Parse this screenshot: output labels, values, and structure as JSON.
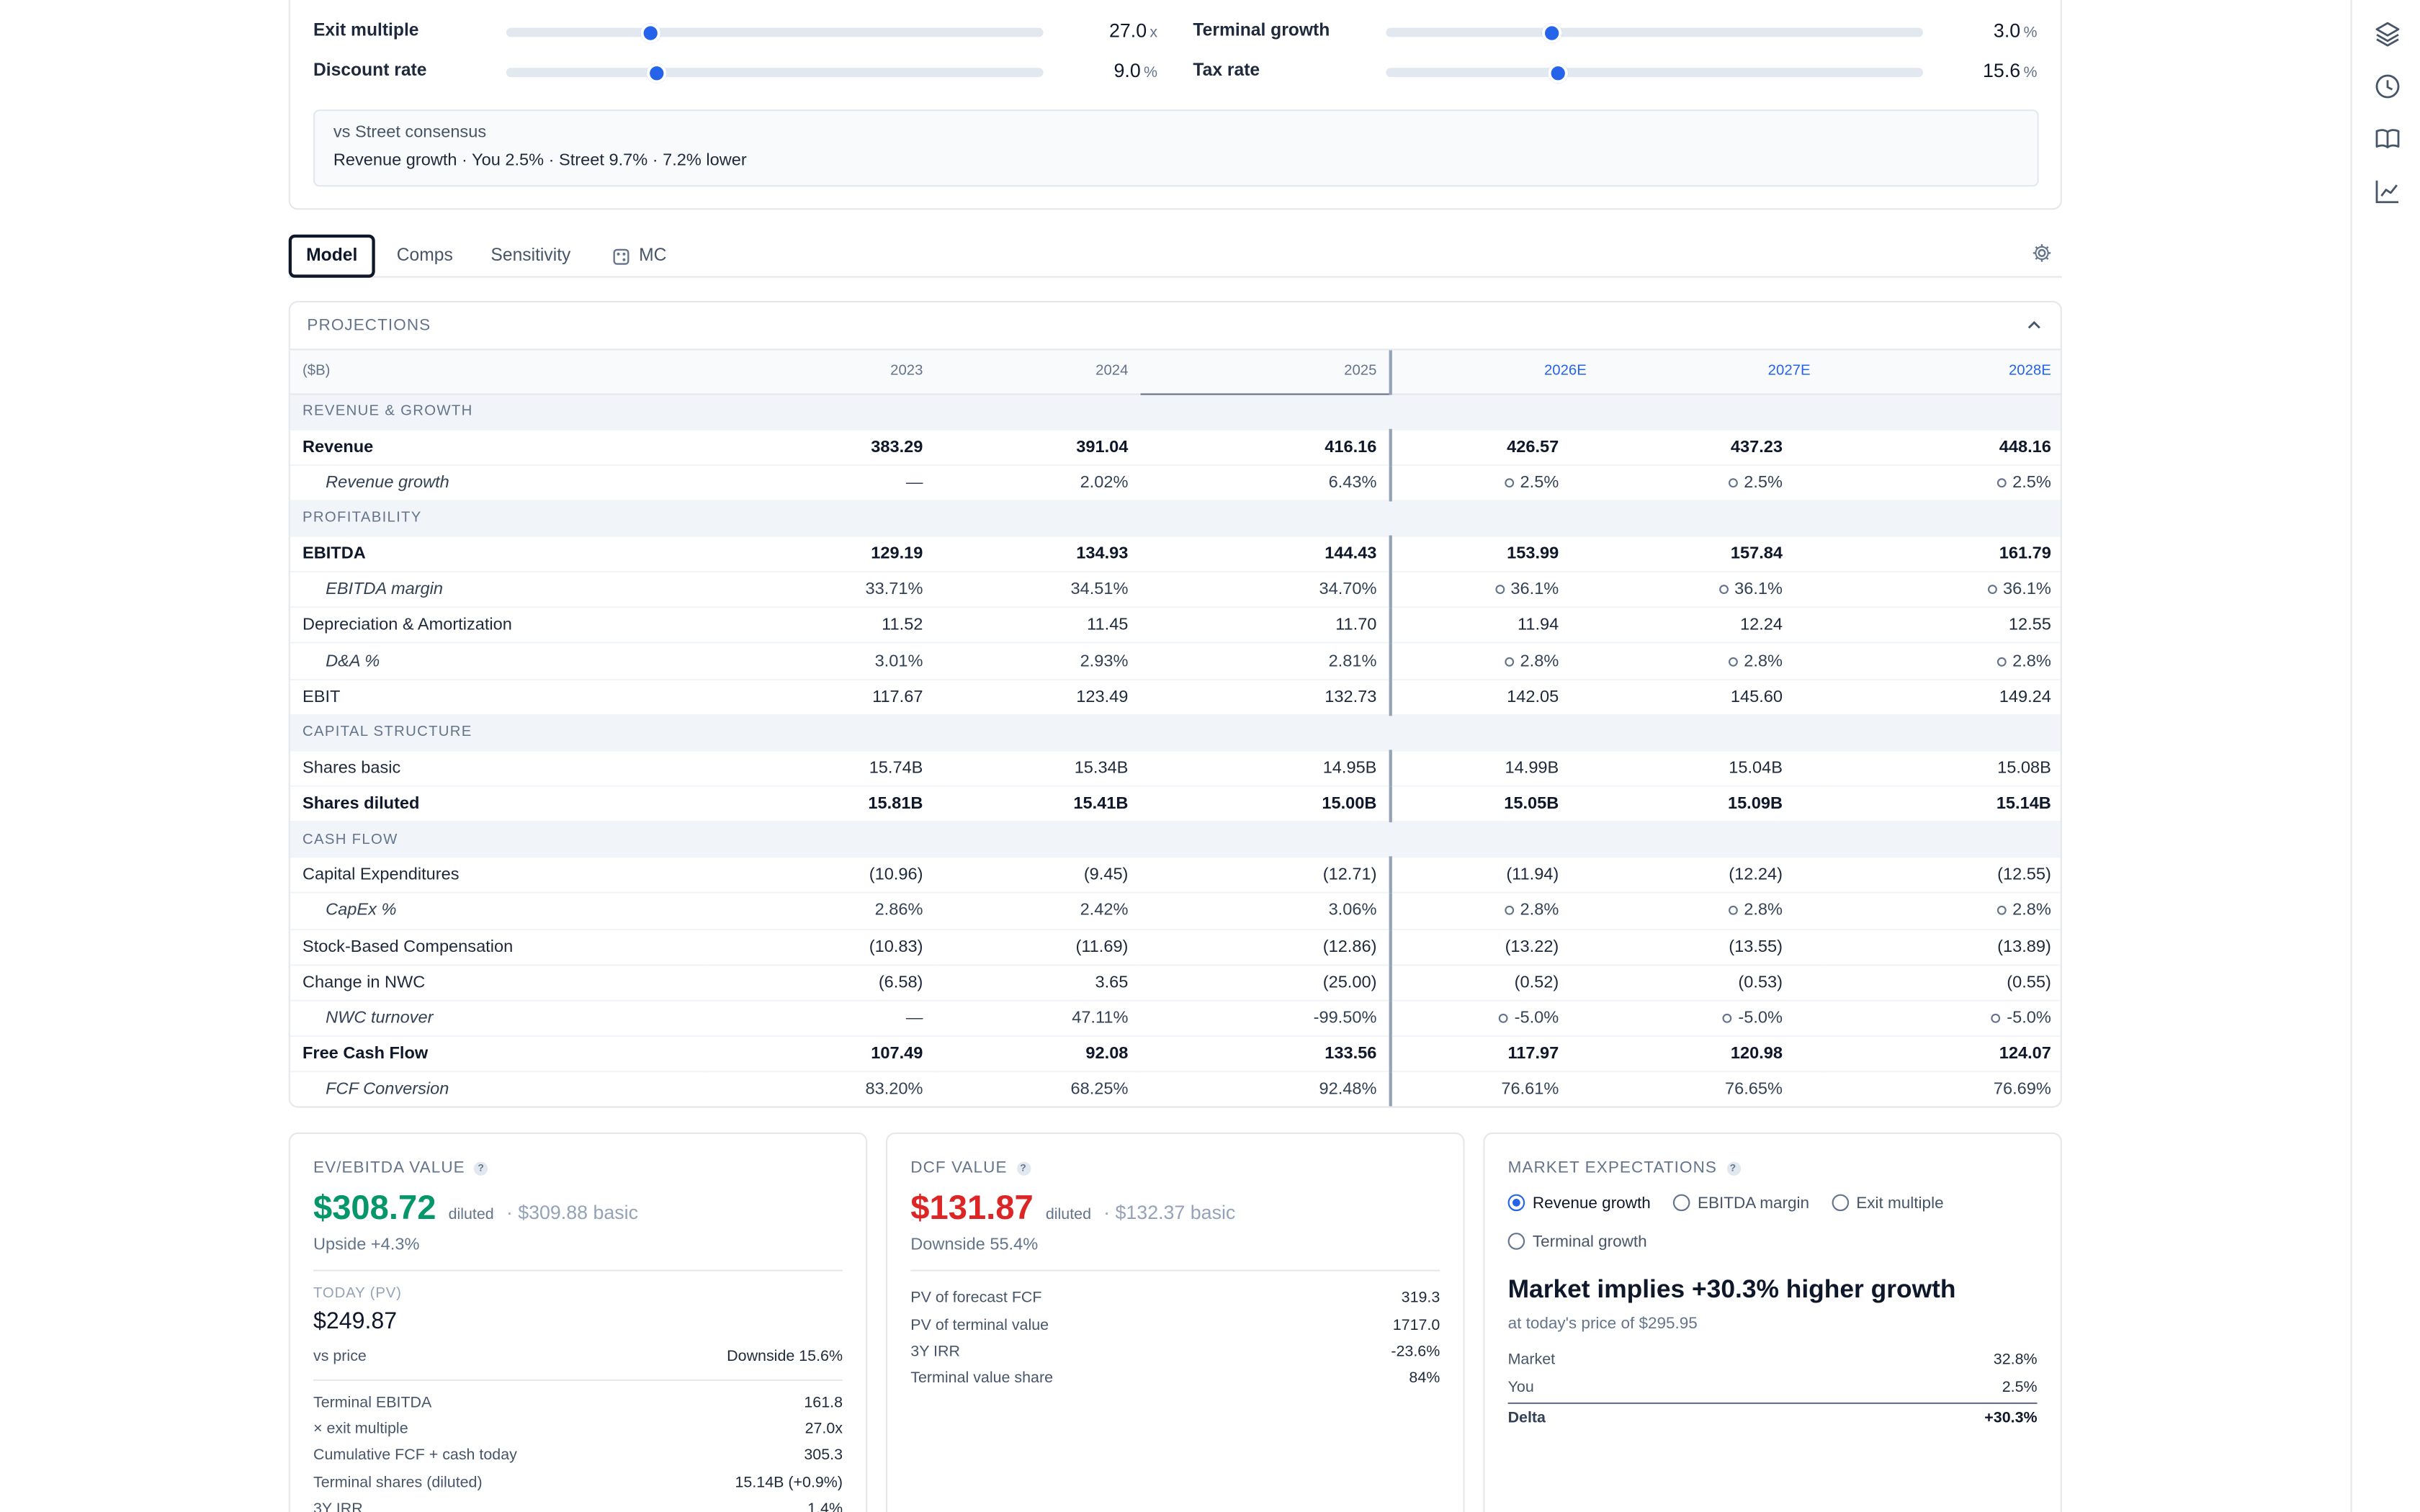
{
  "assumptions": {
    "sliders": [
      {
        "label": "Exit multiple",
        "value": "27.0",
        "unit": "x",
        "fraction": 0.27
      },
      {
        "label": "Terminal growth",
        "value": "3.0",
        "unit": "%",
        "fraction": 0.31
      },
      {
        "label": "Discount rate",
        "value": "9.0",
        "unit": "%",
        "fraction": 0.28
      },
      {
        "label": "Tax rate",
        "value": "15.6",
        "unit": "%",
        "fraction": 0.32
      }
    ],
    "street": {
      "title": "vs Street consensus",
      "detail": "Revenue growth · You 2.5% · Street 9.7% · 7.2% lower"
    }
  },
  "tabs": {
    "model": "Model",
    "comps": "Comps",
    "sensitivity": "Sensitivity",
    "mc": "MC",
    "active": "Model"
  },
  "projections": {
    "title": "PROJECTIONS",
    "columns": [
      "($B)",
      "2023",
      "2024",
      "2025",
      "2026E",
      "2027E",
      "2028E"
    ],
    "sections": [
      {
        "name": "REVENUE & GROWTH",
        "rows": [
          {
            "label": "Revenue",
            "style": "bold",
            "values": [
              "383.29",
              "391.04",
              "416.16",
              "426.57",
              "437.23",
              "448.16"
            ]
          },
          {
            "label": "Revenue growth",
            "style": "sub",
            "driver": true,
            "values": [
              "—",
              "2.02%",
              "6.43%",
              "2.5%",
              "2.5%",
              "2.5%"
            ]
          }
        ]
      },
      {
        "name": "PROFITABILITY",
        "rows": [
          {
            "label": "EBITDA",
            "style": "bold",
            "values": [
              "129.19",
              "134.93",
              "144.43",
              "153.99",
              "157.84",
              "161.79"
            ]
          },
          {
            "label": "EBITDA margin",
            "style": "sub",
            "driver": true,
            "values": [
              "33.71%",
              "34.51%",
              "34.70%",
              "36.1%",
              "36.1%",
              "36.1%"
            ]
          },
          {
            "label": "Depreciation & Amortization",
            "style": "normal",
            "values": [
              "11.52",
              "11.45",
              "11.70",
              "11.94",
              "12.24",
              "12.55"
            ]
          },
          {
            "label": "D&A %",
            "style": "sub",
            "driver": true,
            "values": [
              "3.01%",
              "2.93%",
              "2.81%",
              "2.8%",
              "2.8%",
              "2.8%"
            ]
          },
          {
            "label": "EBIT",
            "style": "normal",
            "values": [
              "117.67",
              "123.49",
              "132.73",
              "142.05",
              "145.60",
              "149.24"
            ]
          }
        ]
      },
      {
        "name": "CAPITAL STRUCTURE",
        "rows": [
          {
            "label": "Shares basic",
            "style": "normal",
            "values": [
              "15.74B",
              "15.34B",
              "14.95B",
              "14.99B",
              "15.04B",
              "15.08B"
            ]
          },
          {
            "label": "Shares diluted",
            "style": "bold",
            "values": [
              "15.81B",
              "15.41B",
              "15.00B",
              "15.05B",
              "15.09B",
              "15.14B"
            ]
          }
        ]
      },
      {
        "name": "CASH FLOW",
        "rows": [
          {
            "label": "Capital Expenditures",
            "style": "normal",
            "values": [
              "(10.96)",
              "(9.45)",
              "(12.71)",
              "(11.94)",
              "(12.24)",
              "(12.55)"
            ]
          },
          {
            "label": "CapEx %",
            "style": "sub",
            "driver": true,
            "values": [
              "2.86%",
              "2.42%",
              "3.06%",
              "2.8%",
              "2.8%",
              "2.8%"
            ]
          },
          {
            "label": "Stock-Based Compensation",
            "style": "normal",
            "values": [
              "(10.83)",
              "(11.69)",
              "(12.86)",
              "(13.22)",
              "(13.55)",
              "(13.89)"
            ]
          },
          {
            "label": "Change in NWC",
            "style": "normal",
            "values": [
              "(6.58)",
              "3.65",
              "(25.00)",
              "(0.52)",
              "(0.53)",
              "(0.55)"
            ]
          },
          {
            "label": "NWC turnover",
            "style": "sub",
            "driver": true,
            "values": [
              "—",
              "47.11%",
              "-99.50%",
              "-5.0%",
              "-5.0%",
              "-5.0%"
            ]
          },
          {
            "label": "Free Cash Flow",
            "style": "bold",
            "values": [
              "107.49",
              "92.08",
              "133.56",
              "117.97",
              "120.98",
              "124.07"
            ]
          },
          {
            "label": "FCF Conversion",
            "style": "sub",
            "values": [
              "83.20%",
              "68.25%",
              "92.48%",
              "76.61%",
              "76.65%",
              "76.69%"
            ]
          }
        ]
      }
    ]
  },
  "ev_card": {
    "title": "EV/EBITDA VALUE",
    "price": "$308.72",
    "diluted": "diluted",
    "basic": "· $309.88 basic",
    "upside": "Upside +4.3%",
    "today_label": "TODAY (PV)",
    "today_value": "$249.87",
    "vs_label": "vs price",
    "vs_value": "Downside 15.6%",
    "rows": [
      {
        "k": "Terminal EBITDA",
        "v": "161.8"
      },
      {
        "k": "× exit multiple",
        "v": "27.0x"
      },
      {
        "k": "Cumulative FCF + cash today",
        "v": "305.3"
      },
      {
        "k": "Terminal shares (diluted)",
        "v": "15.14B (+0.9%)"
      },
      {
        "k": "3Y IRR",
        "v": "1.4%"
      }
    ],
    "color": "#059669"
  },
  "dcf_card": {
    "title": "DCF VALUE",
    "price": "$131.87",
    "diluted": "diluted",
    "basic": "· $132.37 basic",
    "downside": "Downside 55.4%",
    "rows": [
      {
        "k": "PV of forecast FCF",
        "v": "319.3"
      },
      {
        "k": "PV of terminal value",
        "v": "1717.0"
      },
      {
        "k": "3Y IRR",
        "v": "-23.6%"
      },
      {
        "k": "Terminal value share",
        "v": "84%"
      }
    ],
    "color": "#dc2626"
  },
  "market_card": {
    "title": "MARKET EXPECTATIONS",
    "options": [
      "Revenue growth",
      "EBITDA margin",
      "Exit multiple",
      "Terminal growth"
    ],
    "selected": "Revenue growth",
    "headline": "Market implies +30.3% higher growth",
    "subline": "at today's price of $295.95",
    "rows": [
      {
        "k": "Market",
        "v": "32.8%"
      },
      {
        "k": "You",
        "v": "2.5%"
      }
    ],
    "delta_label": "Delta",
    "delta_value": "+30.3%"
  },
  "rail_icons": [
    "layers-icon",
    "clock-icon",
    "book-icon",
    "chart-line-icon"
  ]
}
